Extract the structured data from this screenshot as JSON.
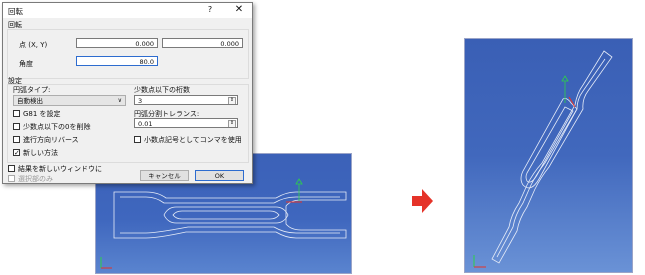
{
  "dialog": {
    "title": "回転",
    "help": "?",
    "close": "✕",
    "rotation_group": "回転",
    "point_label": "点 (X, Y)",
    "x_value": "0.000",
    "y_value": "0.000",
    "angle_label": "角度",
    "angle_value": "80.0",
    "settings_group": "設定",
    "arc_type_label": "円弧タイプ:",
    "arc_type_value": "自動検出",
    "decimals_label": "少数点以下の桁数",
    "decimals_value": "3",
    "g81_label": "G81 を設定",
    "trim_decimals_label": "少数点以下の0を削除",
    "reverse_label": "進行方向リバース",
    "new_method_label": "新しい方法",
    "tolerance_label": "円弧分割トレランス:",
    "tolerance_value": "0.01",
    "comma_label": "小数点記号としてコンマを使用",
    "new_window_label": "結果を新しいウィンドウに",
    "selection_only_label": "選択部のみ",
    "cancel_label": "キャンセル",
    "ok_label": "OK",
    "g81_checked": false,
    "trim_checked": false,
    "reverse_checked": false,
    "new_method_checked": true,
    "comma_checked": false,
    "new_window_checked": false,
    "selection_only_checked": false
  },
  "colors": {
    "viewport": "#3f67be",
    "arrow": "#e53329",
    "toolpath": "#e6ecf8",
    "axis_x": "#e53329",
    "axis_y": "#2bd14a"
  }
}
